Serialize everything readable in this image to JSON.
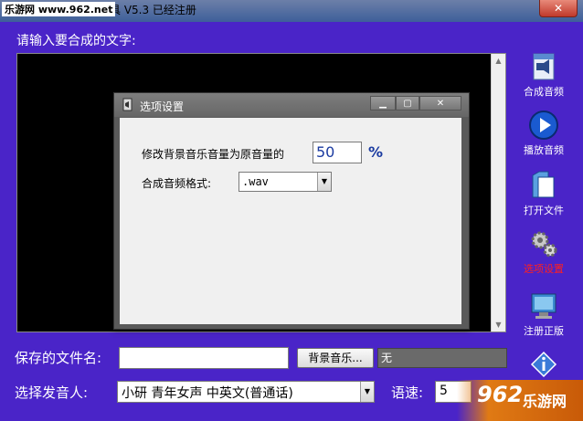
{
  "window": {
    "title": "音工具 V5.3 已经注册",
    "close_label": "✕"
  },
  "watermark_top": "乐游网 www.962.net",
  "prompt": "请输入要合成的文字:",
  "sidebar": [
    {
      "label": "合成音频",
      "color": "#ffffff",
      "icon": "speaker-file-icon"
    },
    {
      "label": "播放音频",
      "color": "#ffffff",
      "icon": "play-icon"
    },
    {
      "label": "打开文件",
      "color": "#ffffff",
      "icon": "open-file-icon"
    },
    {
      "label": "选项设置",
      "color": "#ff2020",
      "icon": "gears-icon"
    },
    {
      "label": "注册正版",
      "color": "#ffffff",
      "icon": "register-icon"
    }
  ],
  "save": {
    "label": "保存的文件名:",
    "value": "",
    "bgm_button": "背景音乐...",
    "bgm_value": "无"
  },
  "voice": {
    "label": "选择发音人:",
    "selected": "小研 青年女声 中英文(普通话)",
    "speed_label": "语速:",
    "speed_value": "5"
  },
  "dialog": {
    "title": "选项设置",
    "volume_label": "修改背景音乐音量为原音量的",
    "volume_value": "50",
    "percent": "%",
    "format_label": "合成音频格式:",
    "format_value": ".wav"
  },
  "watermark_bottom": {
    "brand": "962",
    "sub": "乐游网"
  }
}
